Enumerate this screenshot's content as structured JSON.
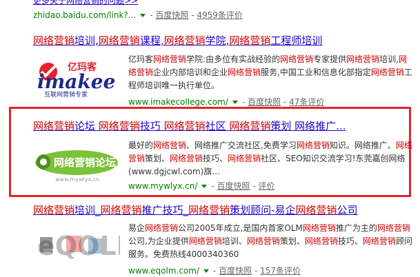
{
  "top": {
    "more_text": "更多关于网络营销的问题>>",
    "url": "zhidao.baidu.com/link?...",
    "cache": "百度快照",
    "reviews": "4959条评价"
  },
  "results": [
    {
      "title_parts": [
        {
          "t": "网络营销",
          "k": true
        },
        {
          "t": "培训,",
          "k": false
        },
        {
          "t": "网络营销",
          "k": true
        },
        {
          "t": "课程,",
          "k": false
        },
        {
          "t": "网络营销",
          "k": true
        },
        {
          "t": "学院,",
          "k": false
        },
        {
          "t": "网络营销",
          "k": true
        },
        {
          "t": "工程师培训",
          "k": false
        }
      ],
      "logo_text": "亿玛客",
      "logo_brand": "imakee",
      "logo_sub": "互联网营销专家",
      "desc_parts": [
        {
          "t": "亿玛客",
          "k": false
        },
        {
          "t": "网络营销",
          "k": true
        },
        {
          "t": "学院:由多位有实战经验的",
          "k": false
        },
        {
          "t": "网络营销",
          "k": true
        },
        {
          "t": "专家提供",
          "k": false
        },
        {
          "t": "网络营销",
          "k": true
        },
        {
          "t": "培训,",
          "k": false
        },
        {
          "t": "网络营销",
          "k": true
        },
        {
          "t": "企业内部培训和企业",
          "k": false
        },
        {
          "t": "网络营销",
          "k": true
        },
        {
          "t": "服务,中国工业和信息化部指定",
          "k": false
        },
        {
          "t": "网络营销",
          "k": true
        },
        {
          "t": "工程师培训唯一执行单位。",
          "k": false
        }
      ],
      "url": "www.imakecollege.com/",
      "cache": "百度快照",
      "reviews": "47条评价"
    },
    {
      "title_parts": [
        {
          "t": "网络营销",
          "k": true
        },
        {
          "t": "论坛  ",
          "k": false
        },
        {
          "t": "网络营销",
          "k": true
        },
        {
          "t": "技巧  ",
          "k": false
        },
        {
          "t": "网络营销",
          "k": true
        },
        {
          "t": "社区  ",
          "k": false
        },
        {
          "t": "网络营销",
          "k": true
        },
        {
          "t": "策划  网络推广...",
          "k": false
        }
      ],
      "logo_text": "网络营销论坛",
      "logo_sub": "www.mywlyx.cn",
      "desc_parts": [
        {
          "t": "最好的",
          "k": false
        },
        {
          "t": "网络营销",
          "k": true
        },
        {
          "t": "、网络推广交流社区,免费学习",
          "k": false
        },
        {
          "t": "网络营销",
          "k": true
        },
        {
          "t": "知识。网络推广、",
          "k": false
        },
        {
          "t": "网络营销",
          "k": true
        },
        {
          "t": "策划、",
          "k": false
        },
        {
          "t": "网络营销",
          "k": true
        },
        {
          "t": "技巧、",
          "k": false
        },
        {
          "t": "网络营销",
          "k": true
        },
        {
          "t": "社区、SEO知识交流学习!东莞嘉创网络(www.dgjcwl.com)旗...",
          "k": false
        }
      ],
      "url": "www.mywlyx.cn/",
      "cache": "百度快照",
      "reviews": "评价"
    },
    {
      "title_parts": [
        {
          "t": "网络营销",
          "k": true
        },
        {
          "t": "培训_",
          "k": false
        },
        {
          "t": "网络营销",
          "k": true
        },
        {
          "t": "推广技巧_",
          "k": false
        },
        {
          "t": "网络营销",
          "k": true
        },
        {
          "t": "策划顾问-易企",
          "k": false
        },
        {
          "t": "网络营销",
          "k": true
        },
        {
          "t": "公司",
          "k": false
        }
      ],
      "logo_text": "eQOLM",
      "desc_parts": [
        {
          "t": "易企",
          "k": false
        },
        {
          "t": "网络营销",
          "k": true
        },
        {
          "t": "公司2005年成立,是国内首家OLM",
          "k": false
        },
        {
          "t": "网络营销",
          "k": true
        },
        {
          "t": "推广为主的",
          "k": false
        },
        {
          "t": "网络营销",
          "k": true
        },
        {
          "t": "公司,为企业提供",
          "k": false
        },
        {
          "t": "网络营销",
          "k": true
        },
        {
          "t": "培训、",
          "k": false
        },
        {
          "t": "网络营销",
          "k": true
        },
        {
          "t": "策划、",
          "k": false
        },
        {
          "t": "网络营销",
          "k": true
        },
        {
          "t": "技巧、",
          "k": false
        },
        {
          "t": "网络营销",
          "k": true
        },
        {
          "t": "顾问服务。免费热线4000340360",
          "k": false
        }
      ],
      "url": "www.eqolm.com/",
      "cache": "百度快照",
      "reviews": "157条评价"
    }
  ]
}
